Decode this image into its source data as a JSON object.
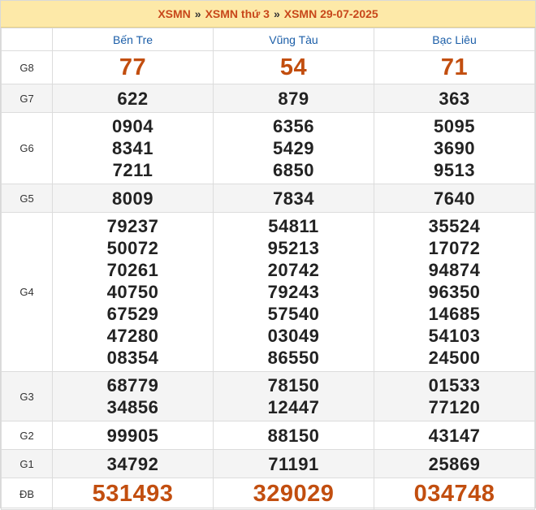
{
  "breadcrumb": [
    "XSMN",
    "XSMN thứ 3",
    "XSMN 29-07-2025"
  ],
  "breadcrumb_separator": "»",
  "provinces": [
    "Bến Tre",
    "Vũng Tàu",
    "Bạc Liêu"
  ],
  "prizes": [
    {
      "label": "G8",
      "values": [
        [
          "77"
        ],
        [
          "54"
        ],
        [
          "71"
        ]
      ]
    },
    {
      "label": "G7",
      "values": [
        [
          "622"
        ],
        [
          "879"
        ],
        [
          "363"
        ]
      ]
    },
    {
      "label": "G6",
      "values": [
        [
          "0904",
          "8341",
          "7211"
        ],
        [
          "6356",
          "5429",
          "6850"
        ],
        [
          "5095",
          "3690",
          "9513"
        ]
      ]
    },
    {
      "label": "G5",
      "values": [
        [
          "8009"
        ],
        [
          "7834"
        ],
        [
          "7640"
        ]
      ]
    },
    {
      "label": "G4",
      "values": [
        [
          "79237",
          "50072",
          "70261",
          "40750",
          "67529",
          "47280",
          "08354"
        ],
        [
          "54811",
          "95213",
          "20742",
          "79243",
          "57540",
          "03049",
          "86550"
        ],
        [
          "35524",
          "17072",
          "94874",
          "96350",
          "14685",
          "54103",
          "24500"
        ]
      ]
    },
    {
      "label": "G3",
      "values": [
        [
          "68779",
          "34856"
        ],
        [
          "78150",
          "12447"
        ],
        [
          "01533",
          "77120"
        ]
      ]
    },
    {
      "label": "G2",
      "values": [
        [
          "99905"
        ],
        [
          "88150"
        ],
        [
          "43147"
        ]
      ]
    },
    {
      "label": "G1",
      "values": [
        [
          "34792"
        ],
        [
          "71191"
        ],
        [
          "25869"
        ]
      ]
    },
    {
      "label": "ĐB",
      "values": [
        [
          "531493"
        ],
        [
          "329029"
        ],
        [
          "034748"
        ]
      ]
    }
  ],
  "colors": {
    "highlight": "#c24e0f",
    "header_bg": "#fde9a8",
    "province": "#1b5ea8"
  }
}
